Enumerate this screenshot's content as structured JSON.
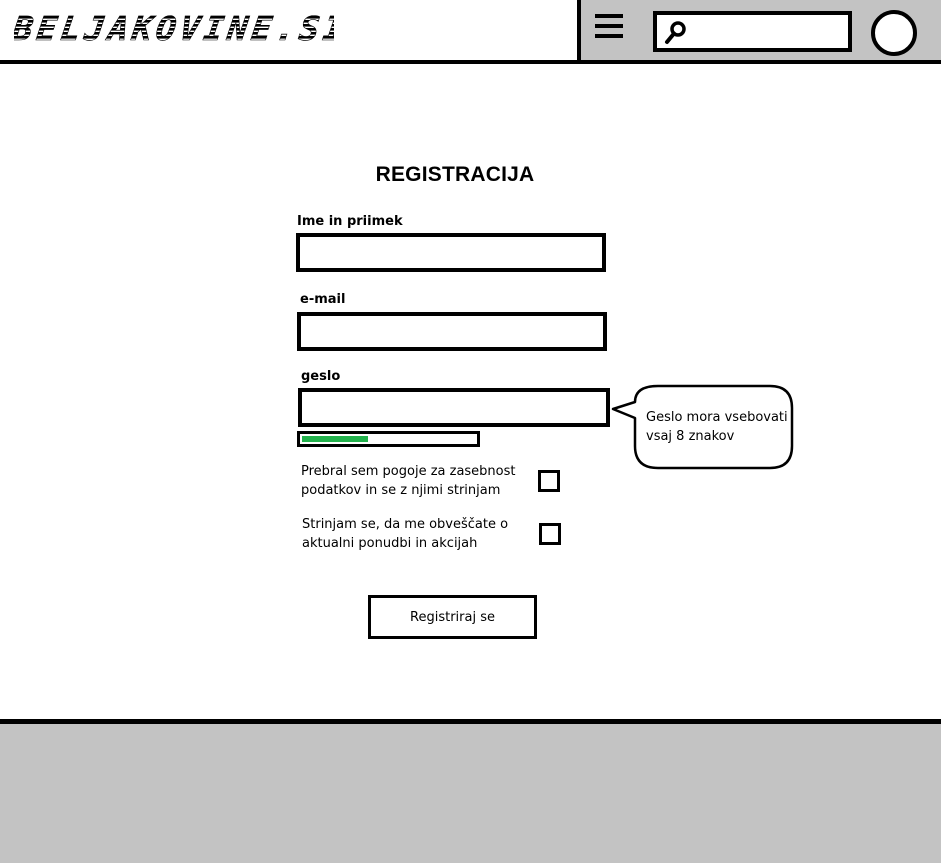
{
  "header": {
    "logo_text": "BELJAKOVINE.SI",
    "menu_icon": "hamburger-menu-icon",
    "search": {
      "icon": "search-icon",
      "placeholder": "",
      "value": ""
    },
    "avatar_icon": "user-avatar-circle"
  },
  "form": {
    "title": "REGISTRACIJA",
    "name_label": "Ime in priimek",
    "name_value": "",
    "email_label": "e-mail",
    "email_value": "",
    "password_label": "geslo",
    "password_value": "",
    "password_strength": 0.38,
    "password_strength_color": "#22b14c",
    "password_hint": "Geslo mora vsebovati vsaj 8 znakov",
    "privacy_consent_label": "Prebral sem pogoje za zasebnost podatkov in se z njimi strinjam",
    "privacy_consent_checked": false,
    "newsletter_consent_label": "Strinjam se, da me obveščate o aktualni ponudbi in akcijah",
    "newsletter_consent_checked": false,
    "submit_label": "Registriraj se"
  },
  "colors": {
    "header_panel": "#c3c3c3",
    "footer": "#c3c3c3",
    "border": "#000000",
    "strength_fill": "#22b14c"
  }
}
